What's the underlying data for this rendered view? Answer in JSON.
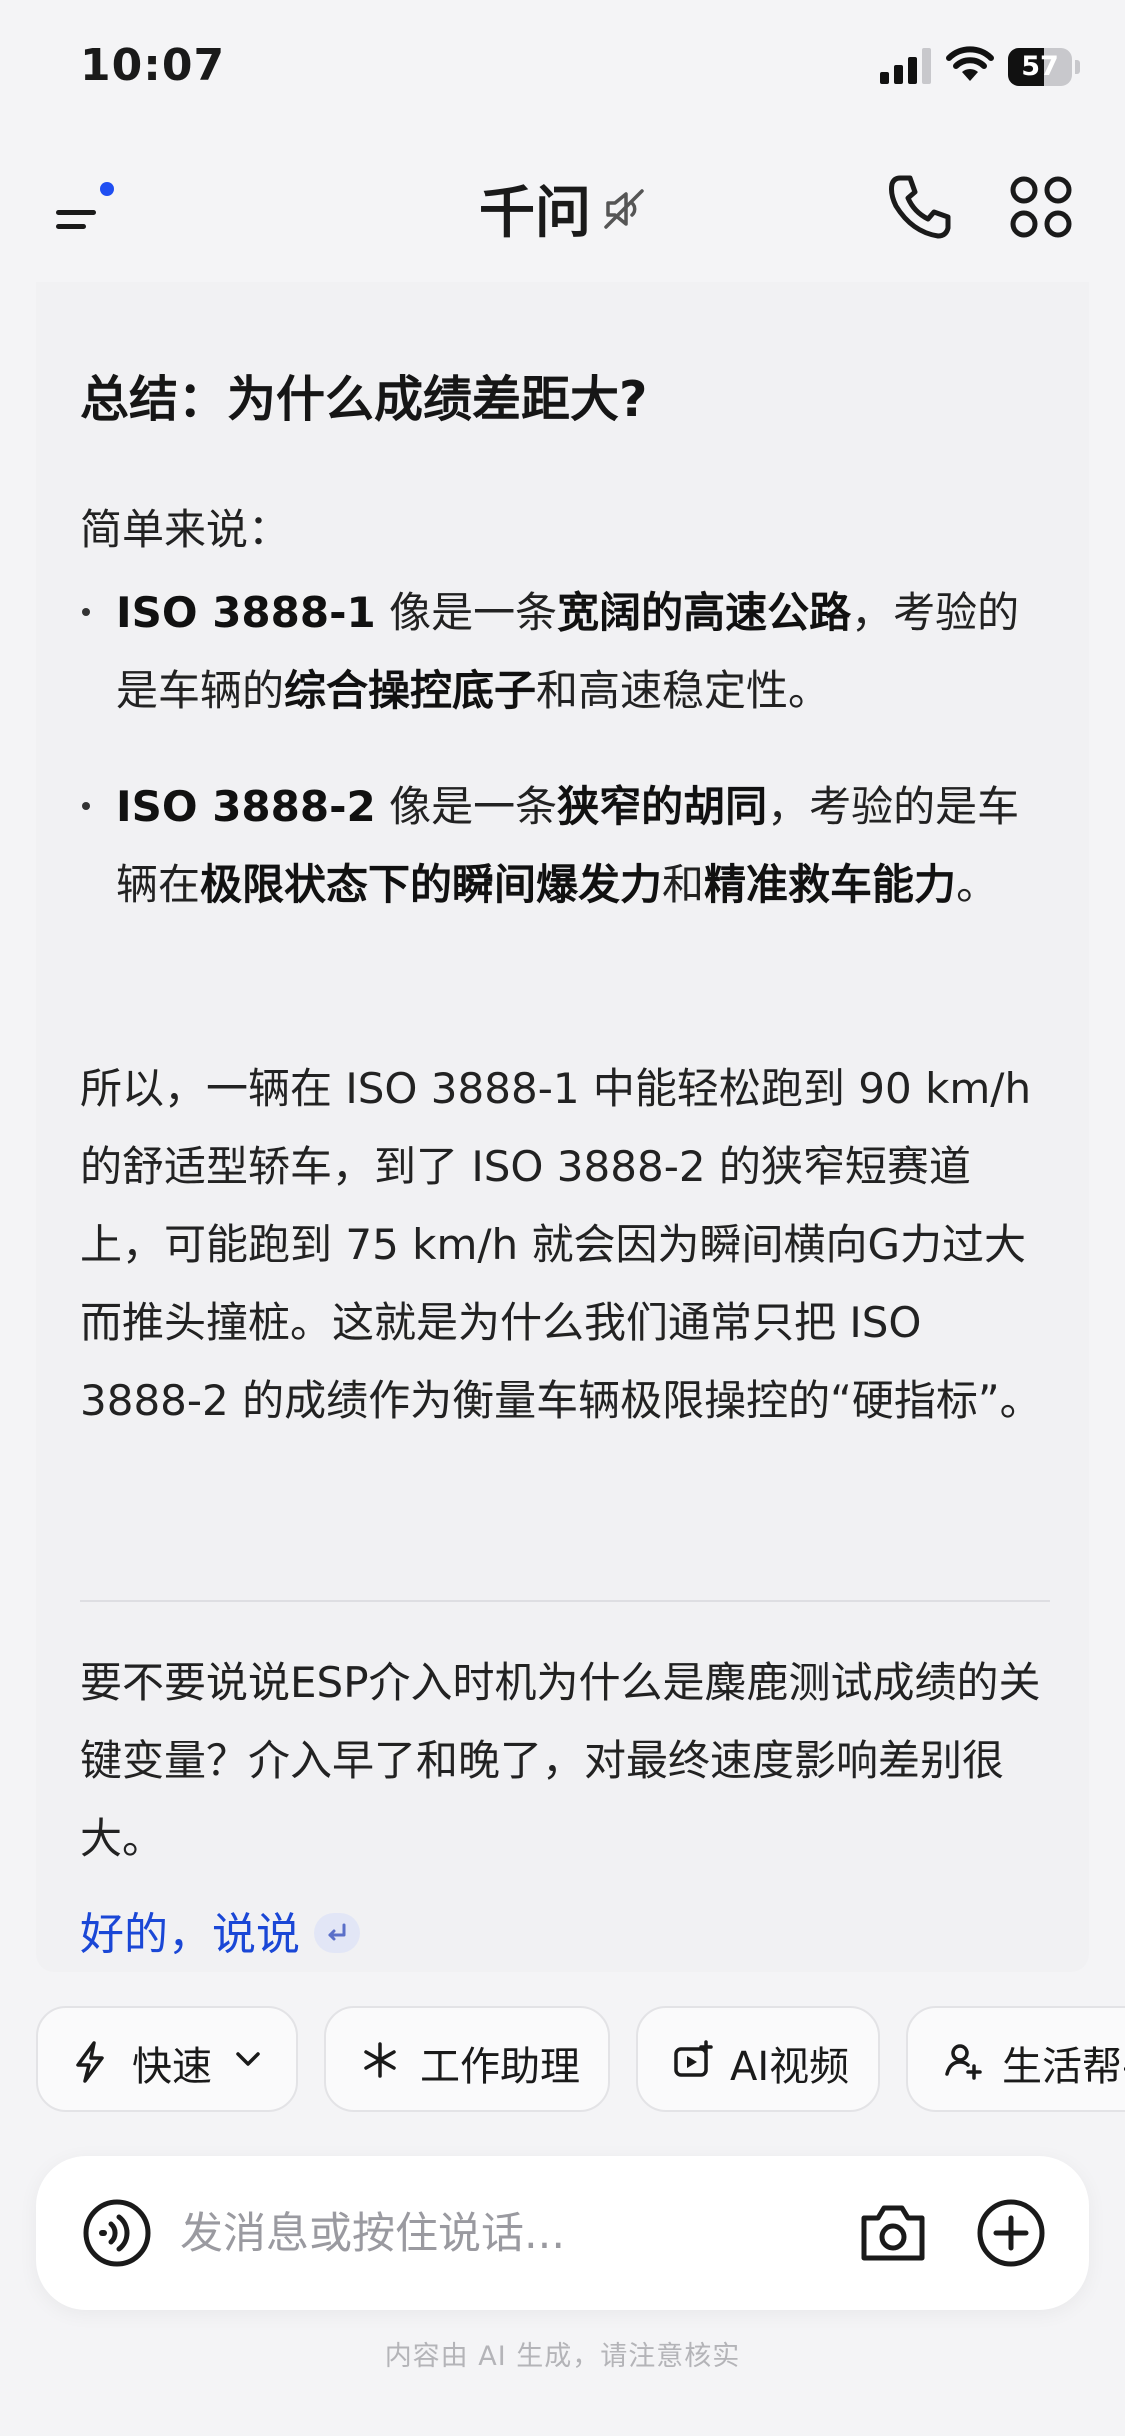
{
  "status_bar": {
    "time": "10:07",
    "battery": "57",
    "battery_level": 0.57
  },
  "header": {
    "title": "千问"
  },
  "message": {
    "heading": "总结：为什么成绩差距大?",
    "intro": "简单来说：",
    "bullets": [
      {
        "b1": "ISO 3888-1",
        "t1": " 像是一条",
        "b2": "宽阔的高速公路",
        "t2": "，考验的是车辆的",
        "b3": "综合操控底子",
        "t3": "和高速稳定性。"
      },
      {
        "b1": "ISO 3888-2",
        "t1": " 像是一条",
        "b2": "狭窄的胡同",
        "t2": "，考验的是车辆在",
        "b3": "极限状态下的瞬间爆发力",
        "t3": "和",
        "b4": "精准救车能力",
        "t4": "。"
      }
    ],
    "conclusion": "所以，一辆在 ISO 3888-1 中能轻松跑到 90 km/h 的舒适型轿车，到了 ISO 3888-2 的狭窄短赛道上，可能跑到 75 km/h 就会因为瞬间横向G力过大而推头撞桩。这就是为什么我们通常只把 ISO 3888-2 的成绩作为衡量车辆极限操控的“硬指标”。",
    "followup_question": "要不要说说ESP介入时机为什么是麋鹿测试成绩的关键变量？介入早了和晚了，对最终速度影响差别很大。",
    "followup_reply": "好的，说说"
  },
  "modes": [
    {
      "label": "快速",
      "icon": "lightning-icon"
    },
    {
      "label": "工作助理",
      "icon": "sparkle-icon"
    },
    {
      "label": "AI视频",
      "icon": "video-plus-icon"
    },
    {
      "label": "生活帮手",
      "icon": "person-spark-icon"
    }
  ],
  "input": {
    "placeholder": "发消息或按住说话..."
  },
  "disclaimer": "内容由 AI 生成，请注意核实",
  "colors": {
    "accent": "#1f4ef2",
    "link": "#1a47d6",
    "background": "#f4f4f6",
    "card": "#f1f1f3"
  }
}
